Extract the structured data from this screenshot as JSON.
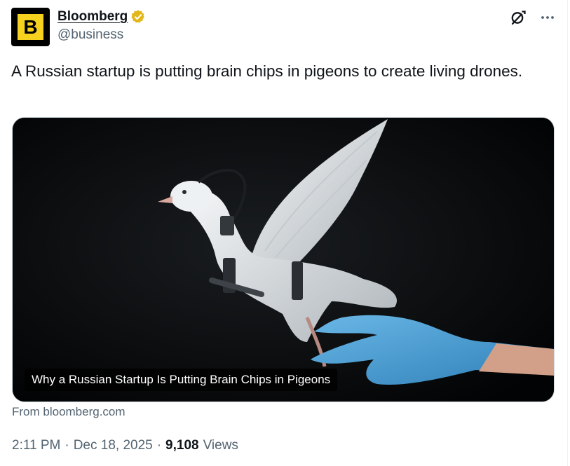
{
  "author": {
    "avatar_letter": "B",
    "display_name": "Bloomberg",
    "handle": "@business",
    "verified_icon": "verified-gold-badge-icon"
  },
  "actions": {
    "grok_icon": "grok-icon",
    "more_icon": "more-horizontal-icon"
  },
  "tweet": {
    "text": "A Russian startup is putting brain chips in pigeons to create living drones."
  },
  "media": {
    "caption": "Why a Russian Startup Is Putting Brain Chips in Pigeons"
  },
  "card": {
    "source": "From bloomberg.com"
  },
  "meta": {
    "time": "2:11 PM",
    "separator": "·",
    "date": "Dec 18, 2025",
    "views_count": "9,108",
    "views_label": "Views"
  },
  "colors": {
    "avatar_tile": "#f6d21e",
    "verified": "#e2b719",
    "secondary_text": "#536471",
    "glove": "#4a9fd4"
  }
}
